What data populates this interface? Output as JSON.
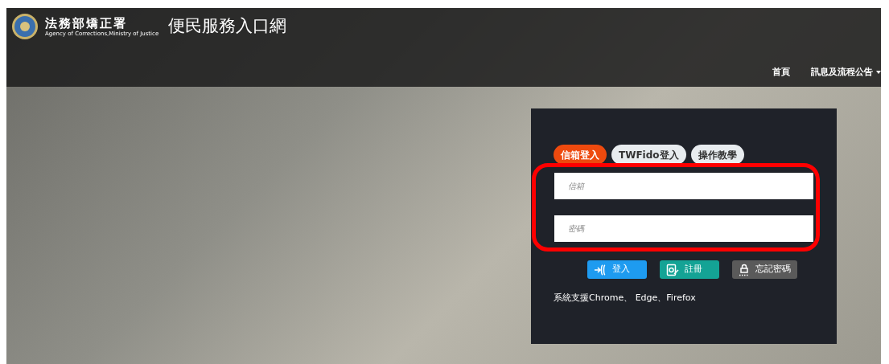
{
  "header": {
    "agency_name": "法務部矯正署",
    "agency_name_en": "Agency of Corrections,Ministry of Justice",
    "portal_title": "便民服務入口網"
  },
  "nav": [
    {
      "label": "首頁",
      "has_menu": false
    },
    {
      "label": "訊息及流程公告",
      "has_menu": true
    }
  ],
  "login": {
    "tabs": [
      {
        "label": "信箱登入",
        "selected": true
      },
      {
        "label": "TWFido登入",
        "selected": false
      },
      {
        "label": "操作教學",
        "selected": false
      }
    ],
    "fields": [
      {
        "placeholder": "信箱"
      },
      {
        "placeholder": "密碼"
      }
    ],
    "highlighted": true,
    "buttons": [
      {
        "label": "登入",
        "kind": "login"
      },
      {
        "label": "註冊",
        "kind": "register"
      },
      {
        "label": "忘記密碼",
        "kind": "forgot"
      }
    ],
    "support_note": "系統支援Chrome、 Edge、Firefox"
  }
}
